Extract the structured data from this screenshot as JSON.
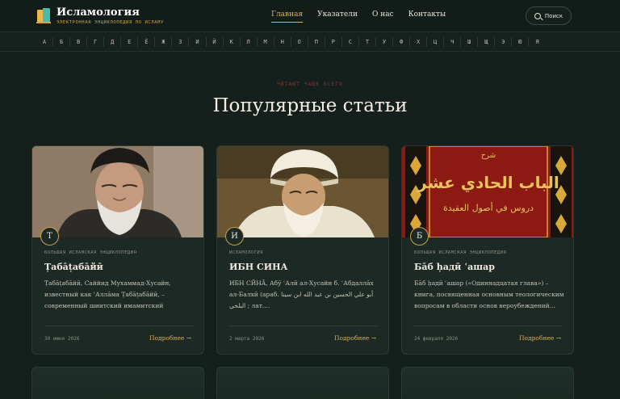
{
  "header": {
    "site_name": "Исламология",
    "tagline": "ЭЛЕКТРОННАЯ ЭНЦИКЛОПЕДИЯ ПО ИСЛАМУ",
    "nav": [
      "Главная",
      "Указатели",
      "О нас",
      "Контакты"
    ],
    "active_nav": "Главная",
    "search_label": "Поиск"
  },
  "alphabet": [
    "А",
    "Б",
    "В",
    "Г",
    "Д",
    "Е",
    "Ё",
    "Ж",
    "З",
    "И",
    "Й",
    "К",
    "Л",
    "М",
    "Н",
    "О",
    "П",
    "Р",
    "С",
    "Т",
    "У",
    "Ф",
    "Х",
    "Ц",
    "Ч",
    "Ш",
    "Щ",
    "Э",
    "Ю",
    "Я"
  ],
  "section": {
    "kicker": "ЧИТАЮТ ЧАЩЕ ВСЕГО",
    "title": "Популярные статьи"
  },
  "cards": [
    {
      "letter": "Т",
      "category": "БОЛЬШАЯ ИСЛАМСКАЯ ЭНЦИКЛОПЕДИЯ",
      "title": "Ṭабāṭабāйӣ",
      "description": "Ṭабāṭабāйӣ, Саййид Мухаммад-Хусайн, известный как ʿАллāма Ṭабāṭабāйӣ, – современный шиитский имамитский философ...",
      "date": "30 июня 2026",
      "more": "Подробнее →"
    },
    {
      "letter": "И",
      "category": "ИСЛАМОЛОГИЯ",
      "title": "ИБН СИНА",
      "description": "ИБН СӢНĀ, Абӯ ʿАлӣ ал-Хусайн б. ʿАбдаллāх ал-Балхӣ (араб. أبو علي الحسين بن عبد الله ابن سينا البلخي ; лат....",
      "date": "2 марта 2026",
      "more": "Подробнее →"
    },
    {
      "letter": "Б",
      "category": "БОЛЬШАЯ ИСЛАМСКАЯ ЭНЦИКЛОПЕДИЯ",
      "title": "Бāб ḥадӣ ʿашар",
      "description": "Бāб ḥадӣ ʿашар («Одиннадцатая глава») – книга, посвященная основным теологическим вопросам в области основ вероубеждений...",
      "date": "24 февраля 2026",
      "more": "Подробнее →"
    }
  ],
  "book_cover_text": {
    "top": "شرح",
    "main": "الباب الحادي عشر",
    "sub": "دروس في أصول العقيدة"
  },
  "colors": {
    "background": "#15201c",
    "accent": "#d8b058",
    "card": "#1c2924",
    "kicker": "#7a3a38"
  }
}
